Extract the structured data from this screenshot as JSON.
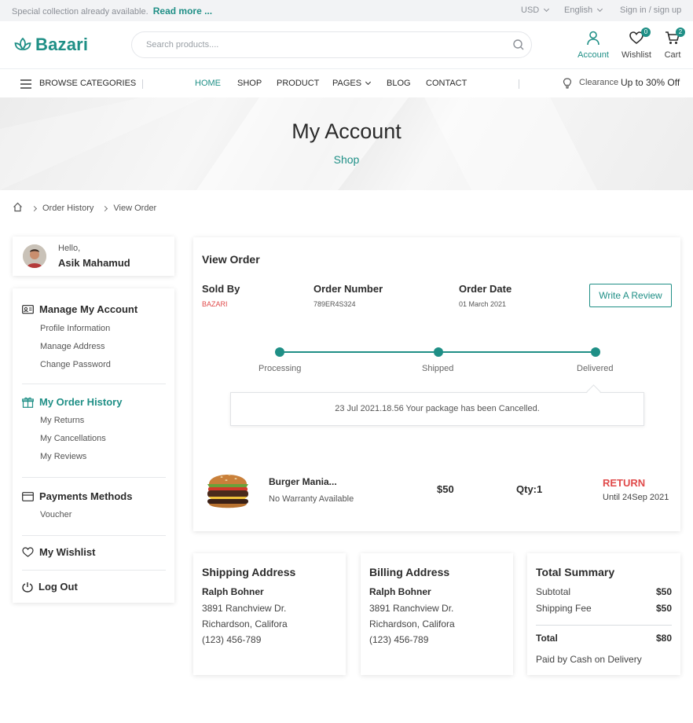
{
  "topbar": {
    "promo_text": "Special collection already available.",
    "read_more": "Read more ...",
    "currency": "USD",
    "language": "English",
    "auth": "Sign in / sign up"
  },
  "header": {
    "logo": "Bazari",
    "search_placeholder": "Search products....",
    "account_label": "Account",
    "wishlist_label": "Wishlist",
    "wishlist_count": "0",
    "cart_label": "Cart",
    "cart_count": "2"
  },
  "nav": {
    "browse": "BROWSE CATEGORIES",
    "items": [
      "HOME",
      "SHOP",
      "PRODUCT",
      "PAGES",
      "BLOG",
      "CONTACT"
    ],
    "active": "HOME",
    "clearance_label": "Clearance",
    "clearance_offer": "Up to 30% Off"
  },
  "hero": {
    "title": "My Account",
    "subtitle": "Shop"
  },
  "breadcrumb": [
    "Order History",
    "View Order"
  ],
  "profile": {
    "greeting": "Hello,",
    "name": "Asik Mahamud"
  },
  "sidebar": {
    "manage_account": "Manage My Account",
    "manage_links": [
      "Profile Information",
      "Manage Address",
      "Change Password"
    ],
    "order_history": "My Order History",
    "order_links": [
      "My Returns",
      "My Cancellations",
      "My Reviews"
    ],
    "payments": "Payments Methods",
    "payment_links": [
      "Voucher"
    ],
    "wishlist": "My Wishlist",
    "logout": "Log Out"
  },
  "order": {
    "heading": "View Order",
    "sold_by_label": "Sold By",
    "sold_by_value": "BAZARI",
    "order_number_label": "Order Number",
    "order_number_value": "789ER4S324",
    "order_date_label": "Order Date",
    "order_date_value": "01 March 2021",
    "review_button": "Write A Review",
    "steps": [
      "Processing",
      "Shipped",
      "Delivered"
    ],
    "message": "23 Jul 2021.18.56    Your package has been Cancelled.",
    "product_name": "Burger Mania...",
    "product_warranty": "No Warranty Available",
    "product_price": "$50",
    "product_qty": "Qty:1",
    "return_label": "RETURN",
    "return_until": "Until 24Sep 2021"
  },
  "shipping": {
    "heading": "Shipping Address",
    "name": "Ralph Bohner",
    "line1": "3891 Ranchview Dr.",
    "line2": "Richardson, Califora",
    "phone": "(123) 456-789"
  },
  "billing": {
    "heading": "Billing Address",
    "name": "Ralph Bohner",
    "line1": "3891 Ranchview Dr.",
    "line2": "Richardson, Califora",
    "phone": "(123) 456-789"
  },
  "summary": {
    "heading": "Total Summary",
    "subtotal_label": "Subtotal",
    "subtotal_value": "$50",
    "shipping_label": "Shipping Fee",
    "shipping_value": "$50",
    "total_label": "Total",
    "total_value": "$80",
    "payment_note": "Paid by Cash on Delivery"
  },
  "colors": {
    "brand": "#1f8f86",
    "return": "#e04a4a",
    "seller": "#e04a4a"
  }
}
